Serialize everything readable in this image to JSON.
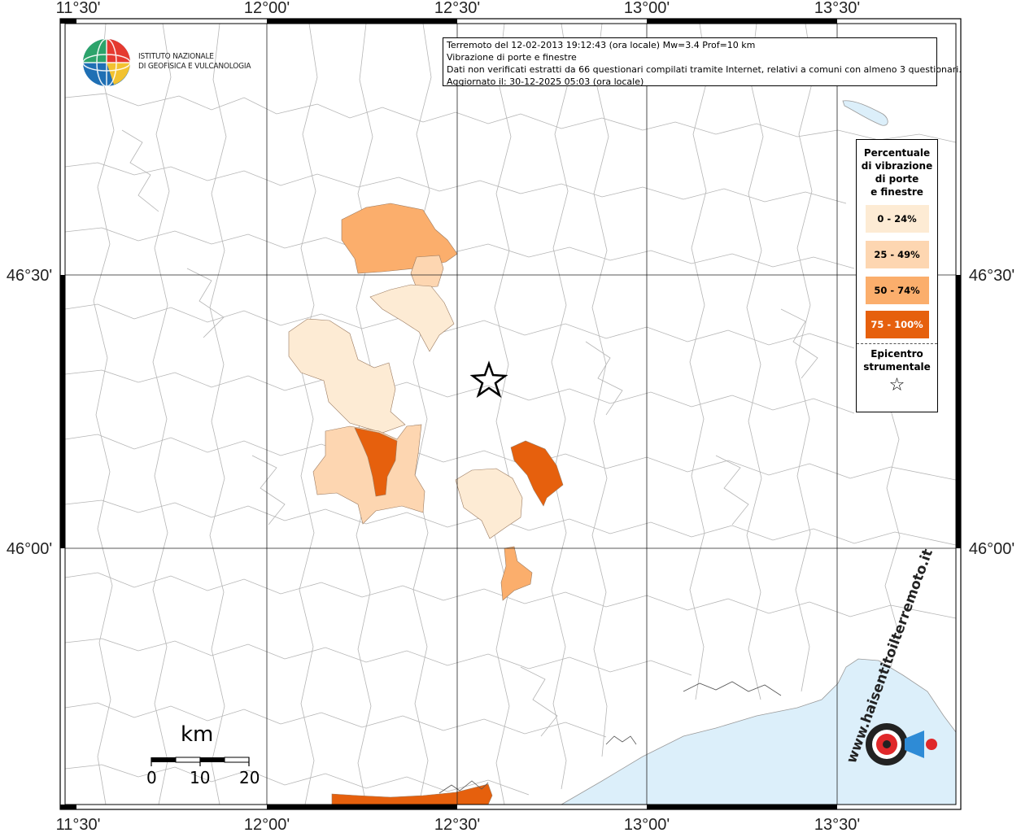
{
  "info": {
    "line1": "Terremoto del 12-02-2013 19:12:43 (ora locale) Mw=3.4 Prof=10 km",
    "line2": "Vibrazione di porte e finestre",
    "line3": "Dati non verificati estratti da 66 questionari compilati tramite Internet, relativi a comuni con almeno 3 questionari.",
    "line4": "Aggiornato il: 30-12-2025 05:03 (ora locale)"
  },
  "ingv": {
    "line1": "ISTITUTO NAZIONALE",
    "line2": "DI GEOFISICA E VULCANOLOGIA"
  },
  "axes": {
    "top": [
      "11°30'",
      "12°00'",
      "12°30'",
      "13°00'",
      "13°30'"
    ],
    "bottom": [
      "11°30'",
      "12°00'",
      "12°30'",
      "13°00'",
      "13°30'"
    ],
    "left": [
      "46°30'",
      "46°00'"
    ],
    "right": [
      "46°30'",
      "46°00'"
    ]
  },
  "legend": {
    "title_lines": [
      "Percentuale",
      "di vibrazione",
      "di porte",
      "e finestre"
    ],
    "classes": [
      {
        "label": "0 - 24%",
        "color": "#fdebd4"
      },
      {
        "label": "25 - 49%",
        "color": "#fdd6b1"
      },
      {
        "label": "50 - 74%",
        "color": "#fbae6c"
      },
      {
        "label": "75 - 100%",
        "color": "#e6600d"
      }
    ],
    "epicenter_lines": [
      "Epicentro",
      "strumentale"
    ],
    "epicenter_symbol": "☆"
  },
  "scale": {
    "unit": "km",
    "labels": [
      "0",
      "10",
      "20"
    ]
  },
  "logo_text": "www.haisentitoilterremoto.it",
  "colors": {
    "sea": "#dceffa",
    "grid": "#222222",
    "border": "#b5b5b5"
  }
}
